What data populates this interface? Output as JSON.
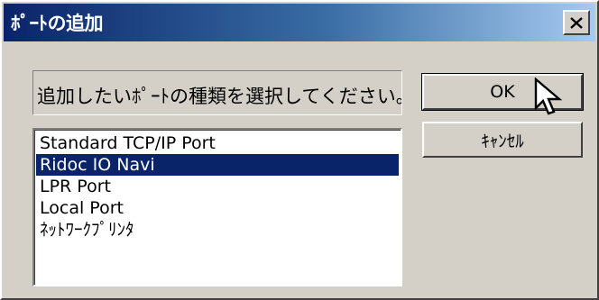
{
  "window": {
    "title": "ﾎﾟｰﾄの追加",
    "close_icon": "close-x-icon"
  },
  "prompt": {
    "text": "追加したいﾎﾟｰﾄの種類を選択してください。"
  },
  "port_list": {
    "items": [
      {
        "label": "Standard TCP/IP Port",
        "selected": false
      },
      {
        "label": "Ridoc IO Navi",
        "selected": true
      },
      {
        "label": "LPR Port",
        "selected": false
      },
      {
        "label": "Local Port",
        "selected": false
      },
      {
        "label": "ﾈｯﾄﾜｰｸﾌﾟﾘﾝﾀ",
        "selected": false
      }
    ]
  },
  "buttons": {
    "ok_label": "OK",
    "cancel_label": "ｷｬﾝｾﾙ"
  },
  "colors": {
    "title_gradient_start": "#0a246a",
    "title_gradient_end": "#a6caf0",
    "selection_bg": "#0a246a",
    "dialog_bg": "#d4d0c8"
  }
}
